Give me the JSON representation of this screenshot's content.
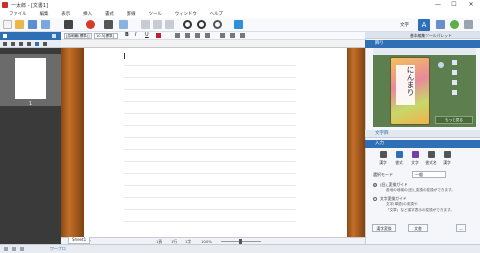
{
  "window": {
    "title": "一太郎 - [文書1]",
    "min": "—",
    "max": "☐",
    "close": "✕"
  },
  "menu": [
    "ファイル",
    "編集",
    "表示",
    "挿入",
    "書式",
    "罫線",
    "ツール",
    "ウィンドウ",
    "ヘルプ"
  ],
  "toolbar": {
    "mode_label": "文字",
    "font_name": "[游明朝(標準)]",
    "font_size": "10.5[標準]",
    "bold": "B",
    "italic": "I",
    "underline": "U"
  },
  "left_panel": {
    "page_number": "1"
  },
  "doc_status": {
    "sheet_tab": "Sheet1",
    "add": "+",
    "pos1": "1頁",
    "pos2": "1行",
    "pos3": "1字",
    "zoom": "100%"
  },
  "right_panel": {
    "header": "基本編集ツールパレット",
    "section_decor": "飾り",
    "card_text": "にんまり",
    "more_button": "もっと見る",
    "section_font": "文字飾",
    "section_input": "入力",
    "tabs": [
      "漢字",
      "書式",
      "文字",
      "書式名",
      "漢字"
    ],
    "mode_label": "選択モード",
    "mode_value": "一般",
    "option1": "(旧)_変換ガイド",
    "option1_desc": "各地の地域の(旧)_変換の変換ができます。",
    "option2": "文字変換ガイド",
    "option2_desc1": "文字(単語)の変換や",
    "option2_desc2": "「文章」など漢字表示の変換ができます。",
    "btn1": "漢字変換",
    "btn2": "文書",
    "btn3": "—"
  },
  "statusbar": {
    "left": "",
    "mid": "ワープロ"
  },
  "colors": {
    "accent": "#2f6fb5",
    "title_icon": "#c9302c",
    "wood": "#a65a1c"
  }
}
